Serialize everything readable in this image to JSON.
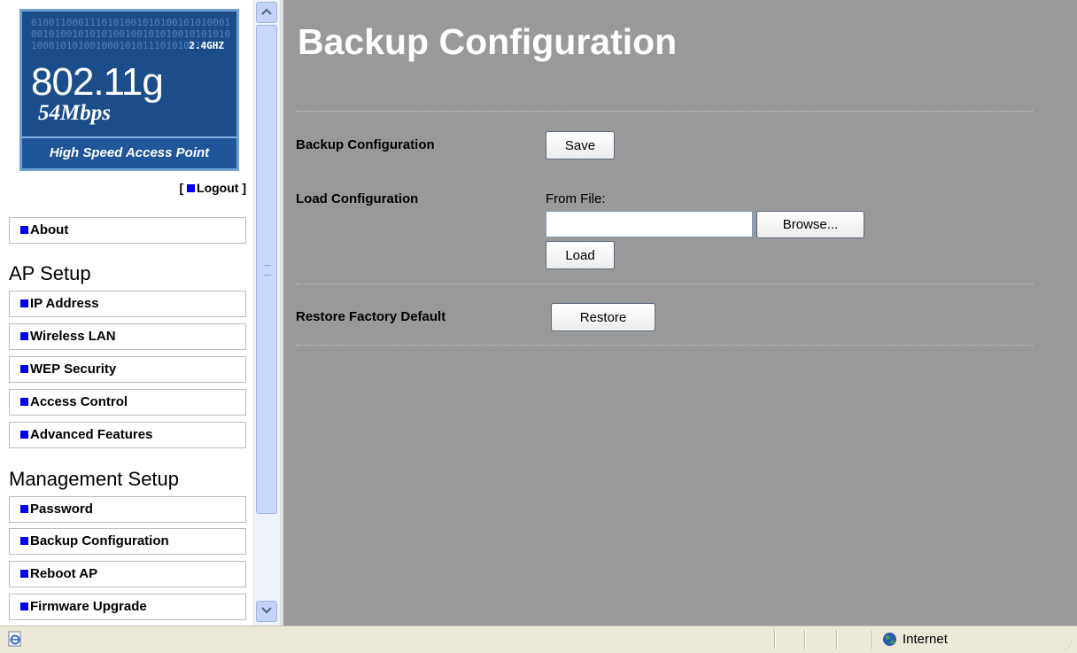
{
  "sidebar": {
    "logo": {
      "binary_text": "01001100011101010010101001010100010010100101010100100101010010101010100010101001000101011101010010101",
      "frequency": "2.4GHZ",
      "standard": "802.11g",
      "speed": "54Mbps",
      "tagline": "High Speed Access Point"
    },
    "logout": {
      "open": "[",
      "label": "Logout",
      "close": "]"
    },
    "about": "About",
    "ap_setup": {
      "title": "AP Setup",
      "items": [
        "IP Address",
        "Wireless LAN",
        "WEP Security",
        "Access Control",
        "Advanced Features"
      ]
    },
    "management_setup": {
      "title": "Management Setup",
      "items": [
        "Password",
        "Backup Configuration",
        "Reboot AP",
        "Firmware Upgrade"
      ]
    }
  },
  "main": {
    "title": "Backup Configuration",
    "backup": {
      "label": "Backup Configuration",
      "button": "Save"
    },
    "load": {
      "label": "Load Configuration",
      "from_file_label": "From File:",
      "file_value": "",
      "browse_button": "Browse...",
      "load_button": "Load"
    },
    "restore": {
      "label": "Restore Factory Default",
      "button": "Restore"
    }
  },
  "statusbar": {
    "zone": "Internet"
  },
  "colors": {
    "content_bg": "#999999",
    "bullet": "#0000ee",
    "logo_bg": "#1b4d8a"
  }
}
